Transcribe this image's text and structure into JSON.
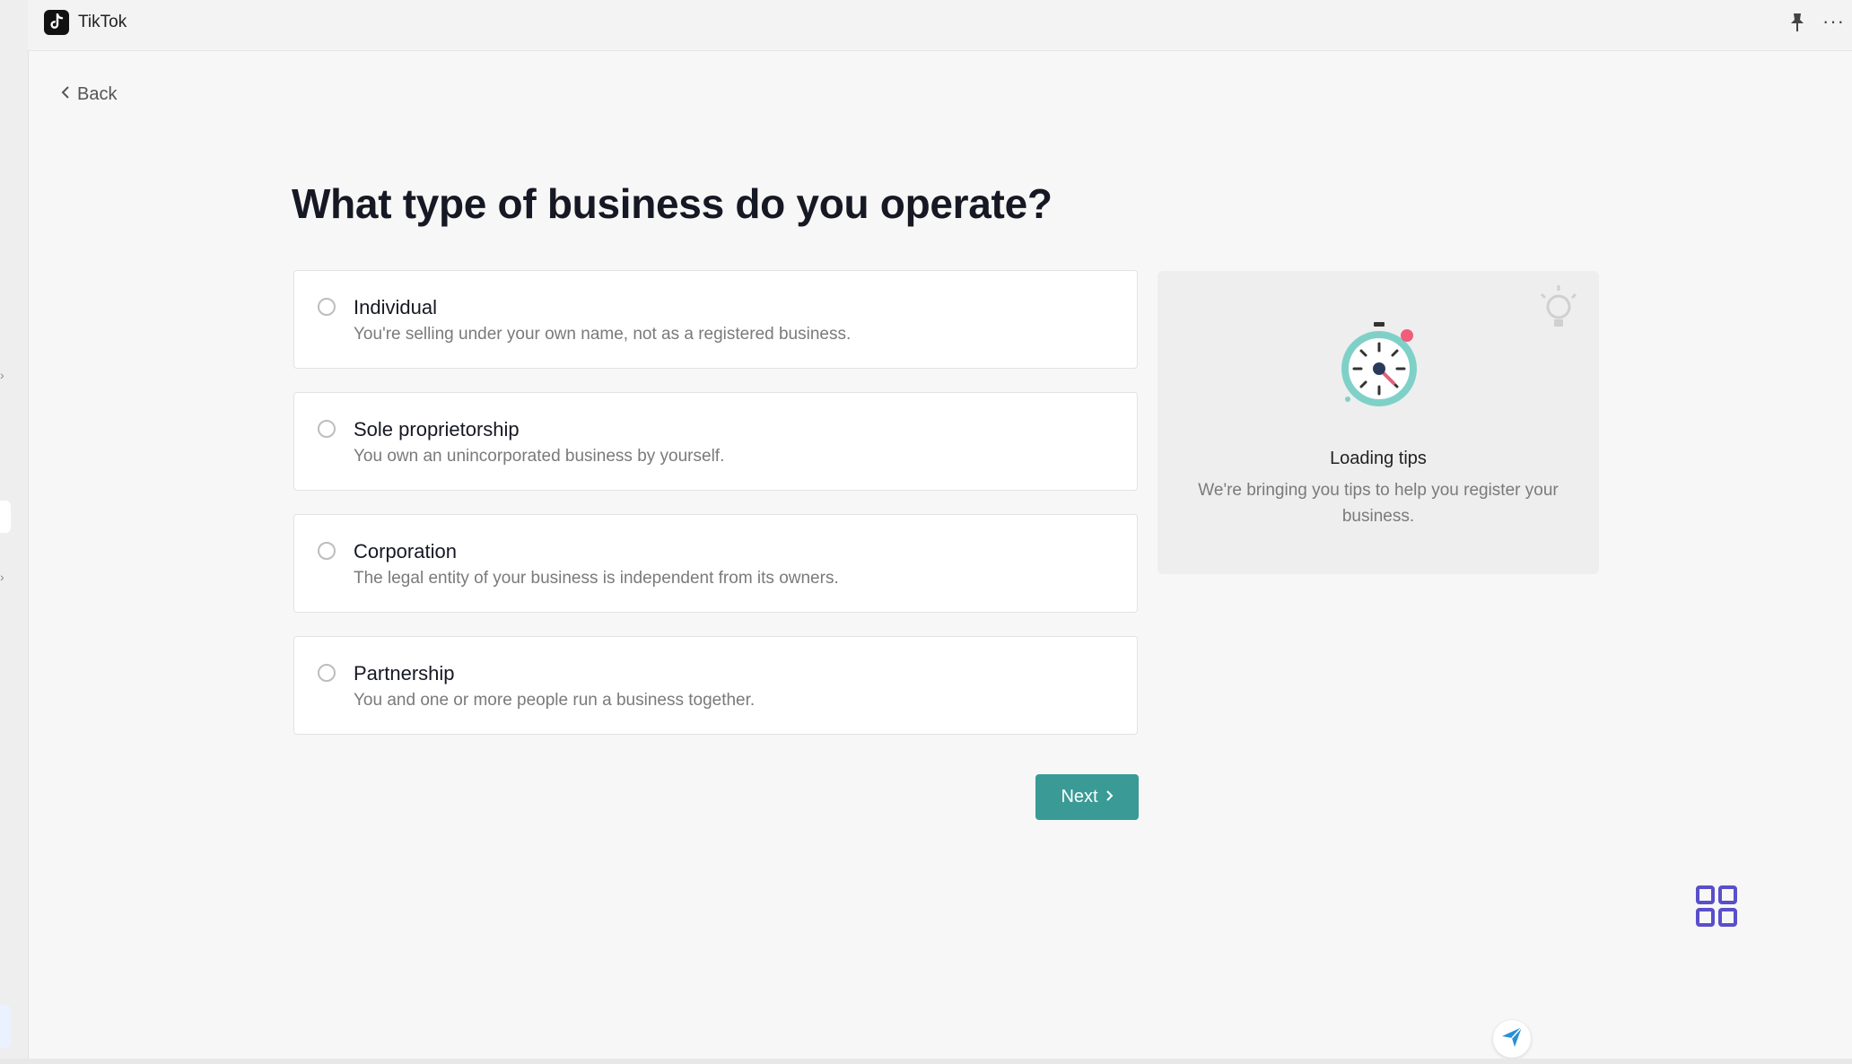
{
  "app": {
    "title": "TikTok"
  },
  "nav": {
    "back_label": "Back"
  },
  "page": {
    "title": "What type of business do you operate?"
  },
  "options": [
    {
      "title": "Individual",
      "desc": "You're selling under your own name, not as a registered business."
    },
    {
      "title": "Sole proprietorship",
      "desc": "You own an unincorporated business by yourself."
    },
    {
      "title": "Corporation",
      "desc": "The legal entity of your business is independent from its owners."
    },
    {
      "title": "Partnership",
      "desc": "You and one or more people run a business together."
    }
  ],
  "actions": {
    "next_label": "Next"
  },
  "tips": {
    "title": "Loading tips",
    "desc": "We're bringing you tips to help you register your business."
  },
  "colors": {
    "accent": "#3a9a96",
    "stopwatch": "#7fd1c8",
    "grid_icon": "#5a4fc9",
    "send_icon": "#2a8fd6"
  },
  "icons": [
    "tiktok-logo-icon",
    "pin-icon",
    "more-icon",
    "chevron-left-icon",
    "chevron-right-icon",
    "lightbulb-icon",
    "stopwatch-icon",
    "grid-icon",
    "send-icon"
  ]
}
